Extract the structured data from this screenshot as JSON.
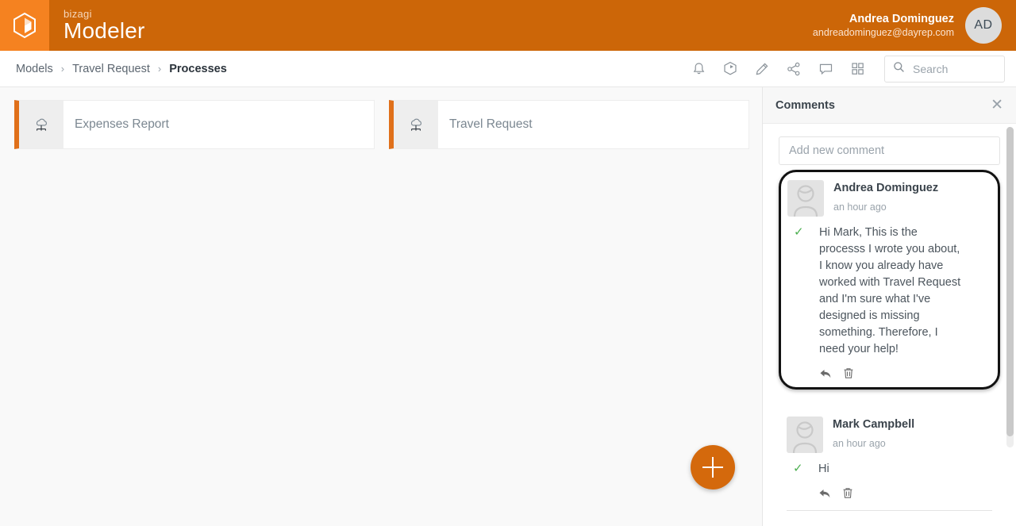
{
  "header": {
    "logo_icon": "cube-logo-icon",
    "brand_small": "bizagi",
    "brand_big": "Modeler",
    "user_name": "Andrea Dominguez",
    "user_email": "andreadominguez@dayrep.com",
    "avatar_initials": "AD",
    "bg_color": "#cc6608",
    "logo_bg_color": "#f58220"
  },
  "breadcrumb": {
    "items": [
      {
        "label": "Models",
        "active": false
      },
      {
        "label": "Travel Request",
        "active": false
      },
      {
        "label": "Processes",
        "active": true
      }
    ],
    "separator": "›"
  },
  "toolbar": {
    "icons": [
      {
        "name": "bell-icon",
        "title": "Notifications"
      },
      {
        "name": "cube-icon",
        "title": "Model"
      },
      {
        "name": "pencil-icon",
        "title": "Edit"
      },
      {
        "name": "share-icon",
        "title": "Share"
      },
      {
        "name": "chat-icon",
        "title": "Comments"
      },
      {
        "name": "grid-icon",
        "title": "Apps"
      }
    ]
  },
  "search": {
    "placeholder": "Search",
    "value": "Search",
    "icon": "search-icon"
  },
  "main": {
    "cards": [
      {
        "title": "Expenses Report",
        "icon": "process-diagram-icon"
      },
      {
        "title": "Travel Request",
        "icon": "process-diagram-icon"
      }
    ],
    "fab": {
      "name": "add-process-button",
      "icon": "plus-icon",
      "color": "#d4690c"
    }
  },
  "comments_panel": {
    "title": "Comments",
    "close_label": "✕",
    "new_comment_placeholder": "Add new comment",
    "comments": [
      {
        "author": "Andrea Dominguez",
        "time": "an hour ago",
        "text": "Hi Mark, This is the processs I wrote you about, I know you already have worked with Travel Request and I'm sure what I've designed is missing something. Therefore, I need your help!",
        "check": "✓",
        "highlighted": true,
        "actions": [
          {
            "name": "reply-icon",
            "label": "Reply"
          },
          {
            "name": "delete-icon",
            "label": "Delete"
          }
        ]
      },
      {
        "author": "Mark Campbell",
        "time": "an hour ago",
        "text": "Hi",
        "check": "✓",
        "highlighted": false,
        "actions": [
          {
            "name": "reply-icon",
            "label": "Reply"
          },
          {
            "name": "delete-icon",
            "label": "Delete"
          }
        ]
      }
    ]
  }
}
